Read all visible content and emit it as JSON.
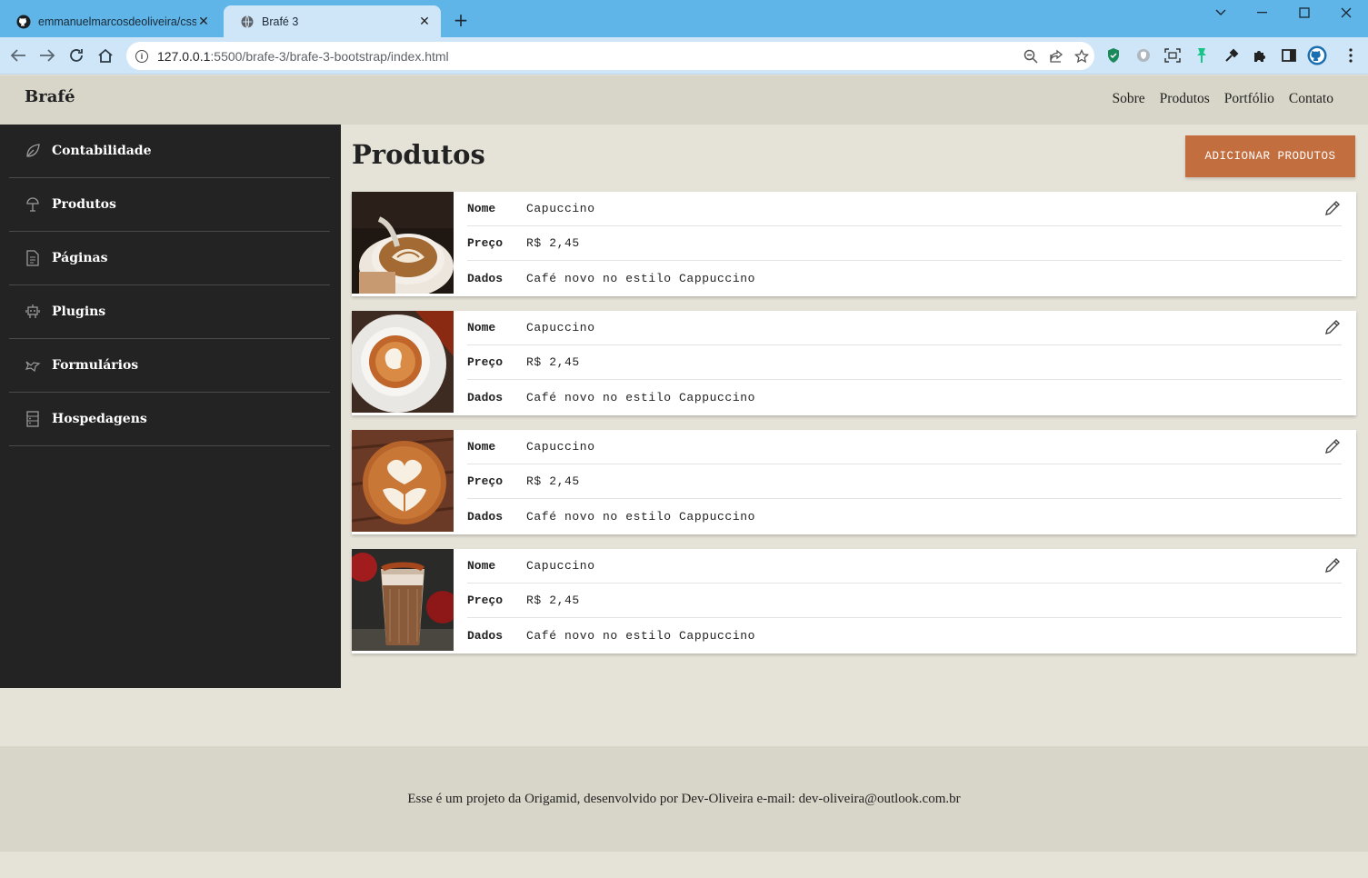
{
  "browser": {
    "tabs": [
      {
        "title": "emmanuelmarcosdeoliveira/css-a",
        "active": false
      },
      {
        "title": "Brafé 3",
        "active": true
      }
    ],
    "url_host": "127.0.0.1",
    "url_rest": ":5500/brafe-3/brafe-3-bootstrap/index.html"
  },
  "header": {
    "brand": "Brafé",
    "nav": [
      "Sobre",
      "Produtos",
      "Portfólio",
      "Contato"
    ]
  },
  "sidebar": {
    "items": [
      {
        "label": "Contabilidade",
        "icon": "leaf-icon"
      },
      {
        "label": "Produtos",
        "icon": "lamp-icon"
      },
      {
        "label": "Páginas",
        "icon": "document-icon"
      },
      {
        "label": "Plugins",
        "icon": "robot-icon"
      },
      {
        "label": "Formulários",
        "icon": "bird-icon"
      },
      {
        "label": "Hospedagens",
        "icon": "server-icon"
      }
    ]
  },
  "main": {
    "title": "Produtos",
    "add_button": "ADICIONAR PRODUTOS",
    "labels": {
      "name": "Nome",
      "price": "Preço",
      "data": "Dados"
    },
    "products": [
      {
        "name": "Capuccino",
        "price": "R$ 2,45",
        "data": "Café novo no estilo Cappuccino",
        "image": "latte-art-pouring"
      },
      {
        "name": "Capuccino",
        "price": "R$ 2,45",
        "data": "Café novo no estilo Cappuccino",
        "image": "latte-art-cup"
      },
      {
        "name": "Capuccino",
        "price": "R$ 2,45",
        "data": "Café novo no estilo Cappuccino",
        "image": "latte-art-swan"
      },
      {
        "name": "Capuccino",
        "price": "R$ 2,45",
        "data": "Café novo no estilo Cappuccino",
        "image": "iced-coffee-glass"
      }
    ]
  },
  "footer": {
    "text": "Esse é um projeto da Origamid, desenvolvido por Dev-Oliveira e-mail: dev-oliveira@outlook.com.br"
  },
  "colors": {
    "accent": "#c36e3f",
    "sidebar_bg": "#232323",
    "header_bg": "#d8d5c9",
    "page_bg": "#e5e2d7",
    "chrome_tabbar": "#5fb4e8"
  }
}
